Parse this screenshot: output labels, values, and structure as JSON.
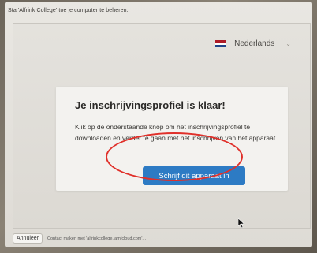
{
  "prompt": {
    "text": "Sta 'Alfrink College' toe je computer te beheren:"
  },
  "language": {
    "label": "Nederlands",
    "flag_colors": [
      "#ae1c28",
      "#ffffff",
      "#21468b"
    ]
  },
  "card": {
    "title": "Je inschrijvingsprofiel is klaar!",
    "body": "Klik op de onderstaande knop om het inschrijvingsprofiel te downloaden en verder te gaan met het inschrijven van het apparaat.",
    "button_label": "Schrijf dit apparaat in"
  },
  "footer": {
    "cancel_label": "Annuleer",
    "status": "Contact maken met 'alfrinkcollege.jamfcloud.com'..."
  },
  "colors": {
    "accent_button": "#2d7bc4",
    "annotation_circle": "#e0302a"
  }
}
